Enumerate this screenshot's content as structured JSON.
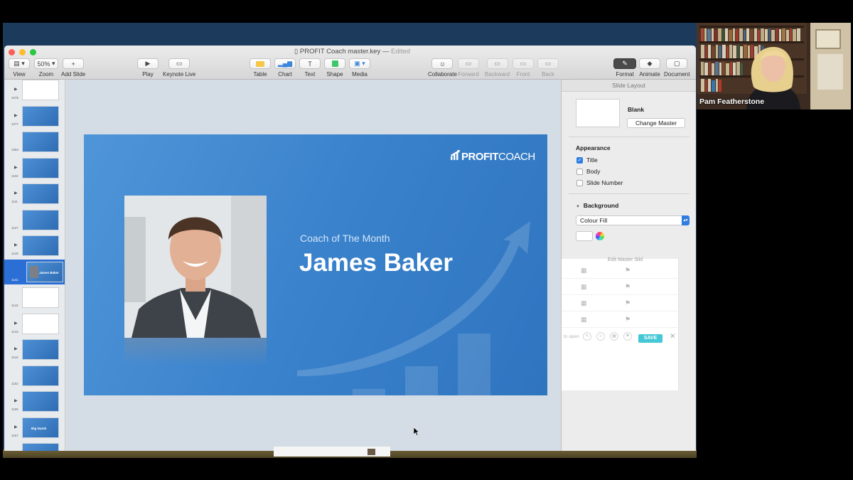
{
  "window": {
    "title": "PROFIT Coach master.key",
    "status": "Edited"
  },
  "toolbar": {
    "view": "View",
    "zoom": "Zoom",
    "zoom_value": "50%",
    "add_slide": "Add Slide",
    "play": "Play",
    "keynote_live": "Keynote Live",
    "table": "Table",
    "chart": "Chart",
    "text": "Text",
    "shape": "Shape",
    "media": "Media",
    "collaborate": "Collaborate",
    "forward": "Forward",
    "backward": "Backward",
    "front": "Front",
    "back": "Back",
    "format": "Format",
    "animate": "Animate",
    "document": "Document"
  },
  "navigator": {
    "slides": [
      {
        "number": "1076",
        "style": "white",
        "text": ""
      },
      {
        "number": "1077",
        "style": "blue",
        "text": ""
      },
      {
        "number": "1084",
        "style": "blue",
        "text": ""
      },
      {
        "number": "1102",
        "style": "blue",
        "text": ""
      },
      {
        "number": "1111",
        "style": "blue",
        "text": ""
      },
      {
        "number": "1127",
        "style": "blue",
        "text": ""
      },
      {
        "number": "1140",
        "style": "blue",
        "text": ""
      },
      {
        "number": "1141",
        "style": "photo",
        "text": ""
      },
      {
        "number": "1142",
        "style": "white",
        "text": ""
      },
      {
        "number": "1143",
        "style": "white",
        "text": ""
      },
      {
        "number": "1144",
        "style": "blue",
        "text": ""
      },
      {
        "number": "1152",
        "style": "blue",
        "text": ""
      },
      {
        "number": "1155",
        "style": "blue",
        "text": ""
      },
      {
        "number": "1157",
        "style": "blue",
        "text": "Big Numb"
      },
      {
        "number": "",
        "style": "blue",
        "text": ""
      }
    ]
  },
  "slide": {
    "logo_bold": "PROFIT",
    "logo_light": "COACH",
    "subtitle": "Coach of The Month",
    "name": "James Baker"
  },
  "inspector": {
    "header": "Slide Layout",
    "master_name": "Blank",
    "change_master": "Change Master",
    "appearance": "Appearance",
    "title_option": "Title",
    "body_option": "Body",
    "slide_number_option": "Slide Number",
    "background": "Background",
    "fill_type": "Colour Fill",
    "overlay_partial": "Edit Master Slid",
    "overlay_save": "SAVE",
    "overlay_open": "to open"
  },
  "webcam": {
    "name": "Pam Featherstone"
  },
  "colors": {
    "accent": "#2f7de1",
    "slide_blue": "#3a82cc",
    "save_teal": "#45c8d6"
  }
}
